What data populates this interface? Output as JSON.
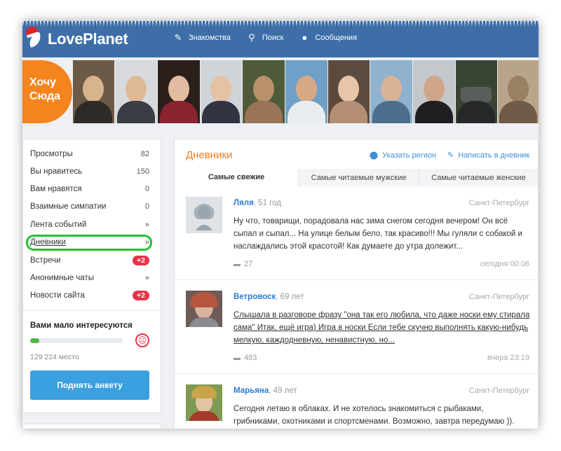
{
  "header": {
    "logo_text": "LovePlanet",
    "nav": [
      {
        "label": "Знакомства",
        "icon": "feather-icon"
      },
      {
        "label": "Поиск",
        "icon": "search-icon"
      },
      {
        "label": "Сообщения",
        "icon": "chat-icon"
      }
    ]
  },
  "promo": {
    "line1": "Хочу",
    "line2": "Сюда"
  },
  "sidebar": {
    "stats": [
      {
        "label": "Просмотры",
        "value": "82"
      },
      {
        "label": "Вы нравитесь",
        "value": "150"
      },
      {
        "label": "Вам нравятся",
        "value": "0"
      },
      {
        "label": "Взаимные симпатии",
        "value": "0"
      },
      {
        "label": "Лента событий",
        "value": "»"
      },
      {
        "label": "Дневники",
        "value": "»"
      },
      {
        "label": "Встречи",
        "value": "+2"
      },
      {
        "label": "Анонимные чаты",
        "value": "»"
      },
      {
        "label": "Новости сайта",
        "value": "+2"
      }
    ],
    "low_interest": "Вами мало интересуются",
    "progress_fraction": 0.1,
    "place": "129 224 место",
    "raise_button": "Поднять анкету"
  },
  "main": {
    "title": "Дневники",
    "action_region": "Указать регион",
    "action_write": "Написать в дневник",
    "tabs": [
      "Самые свежие",
      "Самые читаемые мужские",
      "Самые читаемые женские"
    ],
    "entries": [
      {
        "name": "Ляля",
        "age": ", 51 год",
        "city": "Санкт-Петербург",
        "text": "Ну что, товарищи, порадовала нас зима снегом сегодня вечером! Он всё сыпал и сыпал... На улице белым бело, так красиво!!! Мы гуляли с собакой и наслаждались этой красотой! Как думаете до утра долежит...",
        "comments": "27",
        "time": "сегодня 00:06"
      },
      {
        "name": "Ветровоск",
        "age": ", 69 лет",
        "city": "Санкт-Петербург",
        "text": "Слышала в разговоре фразу \"она так его любила, что даже носки ему стирала сама\" Итак, ещё игра) Игра в носки Если тебе скучно выполнять какую-нибудь мелкую, каждодневную, ненавистную, но...",
        "comments": "483",
        "time": "вчера 23:19"
      },
      {
        "name": "Марьяна",
        "age": ", 49 лет",
        "city": "Санкт-Петербург",
        "text": "Сегодня летаю в облаках. И не хотелось знакомиться с рыбаками, грибниками, охотниками и спортсменами. Возможно, завтра передумаю )). Приходите :*"
      }
    ]
  },
  "colors": {
    "header_blue": "#3d6ea8",
    "accent_orange": "#ef7a1d",
    "link_blue": "#2a7bd0",
    "badge_red": "#e8344a",
    "highlight_green": "#22c431",
    "button_blue": "#3ba0e0"
  }
}
